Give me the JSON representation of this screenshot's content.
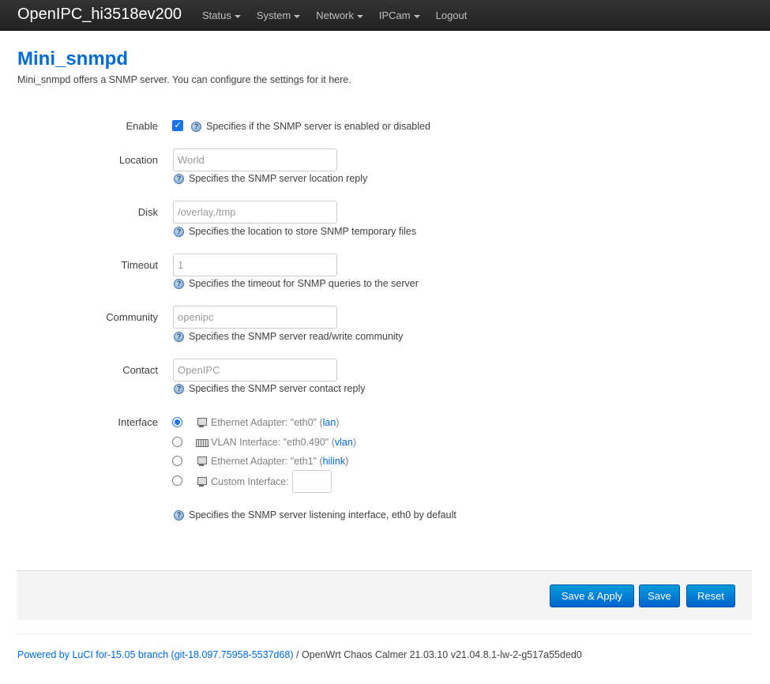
{
  "navbar": {
    "brand": "OpenIPC_hi3518ev200",
    "menu": [
      {
        "label": "Status",
        "dropdown": true
      },
      {
        "label": "System",
        "dropdown": true
      },
      {
        "label": "Network",
        "dropdown": true
      },
      {
        "label": "IPCam",
        "dropdown": true
      },
      {
        "label": "Logout",
        "dropdown": false
      }
    ]
  },
  "page": {
    "title": "Mini_snmpd",
    "description": "Mini_snmpd offers a SNMP server. You can configure the settings for it here."
  },
  "form": {
    "enable": {
      "label": "Enable",
      "checked": true,
      "help": "Specifies if the SNMP server is enabled or disabled"
    },
    "location": {
      "label": "Location",
      "placeholder": "World",
      "help": "Specifies the SNMP server location reply"
    },
    "disk": {
      "label": "Disk",
      "placeholder": "/overlay,/tmp",
      "help": "Specifies the location to store SNMP temporary files"
    },
    "timeout": {
      "label": "Timeout",
      "placeholder": "1",
      "help": "Specifies the timeout for SNMP queries to the server"
    },
    "community": {
      "label": "Community",
      "placeholder": "openipc",
      "help": "Specifies the SNMP server read/write community"
    },
    "contact": {
      "label": "Contact",
      "placeholder": "OpenIPC",
      "help": "Specifies the SNMP server contact reply"
    },
    "interface": {
      "label": "Interface",
      "options": [
        {
          "text": "Ethernet Adapter: \"eth0\"",
          "network": "lan",
          "icon": "ethernet-icon",
          "selected": true
        },
        {
          "text": "VLAN Interface: \"eth0.490\"",
          "network": "vlan",
          "icon": "vlan-icon",
          "selected": false
        },
        {
          "text": "Ethernet Adapter: \"eth1\"",
          "network": "hilink",
          "icon": "ethernet-icon",
          "selected": false
        }
      ],
      "custom_label": "Custom Interface:",
      "help": "Specifies the SNMP server listening interface, eth0 by default"
    }
  },
  "actions": {
    "save_apply": "Save & Apply",
    "save": "Save",
    "reset": "Reset"
  },
  "footer": {
    "powered_by": "Powered by LuCI for-15.05 branch (git-18.097.75958-5537d68)",
    "version": " / OpenWrt Chaos Calmer 21.03.10 v21.04.8.1-lw-2-g517a55ded0"
  },
  "colors": {
    "accent": "#0069d6",
    "navbar": "#222222",
    "button": "#0064cd"
  }
}
